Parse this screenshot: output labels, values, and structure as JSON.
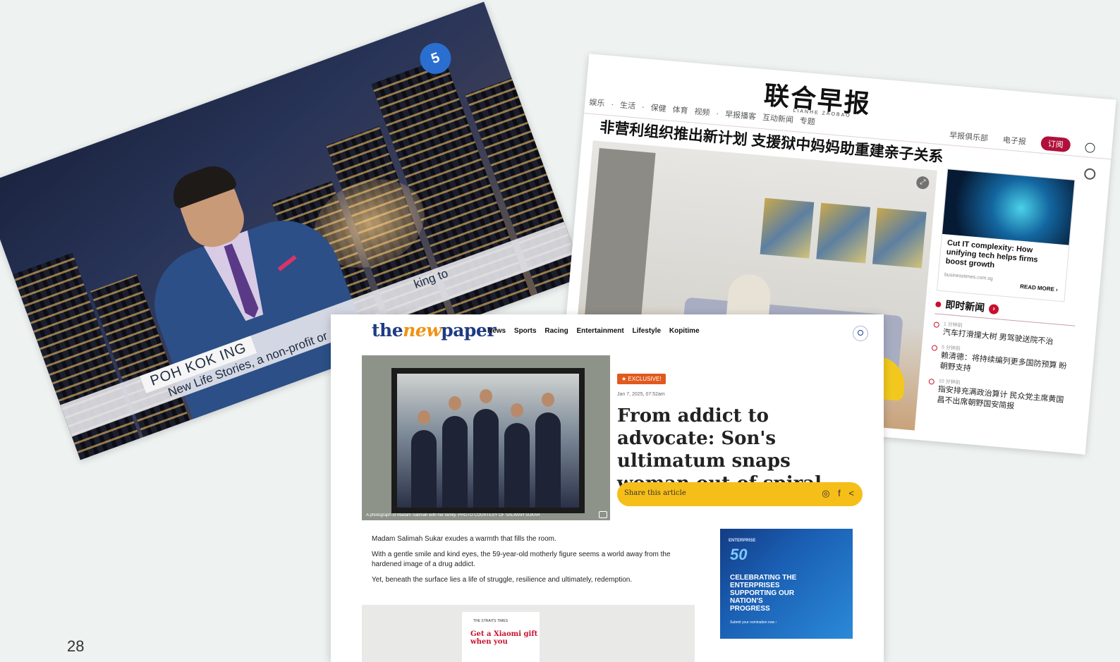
{
  "tv": {
    "channel_logo": "5",
    "anchor_name": "POH KOK ING",
    "ticker": "New Life Stories, a non-profit or",
    "ticker_fragment": "king to"
  },
  "zaobao": {
    "logo": "联合早报",
    "logo_sub": "LIANHE ZAOBAO",
    "nav": "娱乐 · 生活 · 保健 体育 视频 · 早报播客 互动新闻 专题",
    "nav_right": [
      "早报俱乐部",
      "电子报"
    ],
    "subscribe": "订阅",
    "headline": "非营利组织推出新计划 支援狱中妈妈助重建亲子关系",
    "ad": {
      "title": "Cut IT complexity: How unifying tech helps firms boost growth",
      "domain": "businesstimes.com.sg",
      "cta": "READ MORE ›"
    },
    "live_news": {
      "title": "即时新闻",
      "items": [
        {
          "time": "1 分钟前",
          "text": "汽车打滑撞大树 男驾驶送院不治"
        },
        {
          "time": "5 分钟前",
          "text": "赖清德：将持续编列更多国防预算 盼朝野支持"
        },
        {
          "time": "10 分钟前",
          "text": "指安排充满政治算计 民众党主席黄国昌不出席朝野国安简报"
        }
      ]
    }
  },
  "tnp": {
    "logo_the": "the",
    "logo_new": "new",
    "logo_paper": "paper",
    "nav": [
      "News",
      "Sports",
      "Racing",
      "Entertainment",
      "Lifestyle",
      "Kopitime"
    ],
    "photo_caption": "A photograph of Madam Salimah with her family. PHOTO COURTESY OF SALIMAH SUKAR",
    "badge": "EXCLUSIVE!",
    "date": "Jan 7, 2025, 07:52am",
    "title": "From addict to advocate: Son's ultimatum snaps woman out of spiral",
    "share_label": "Share this article",
    "share_icons": "◎ f <",
    "paragraphs": [
      "Madam Salimah Sukar exudes a warmth that fills the room.",
      "With a gentle smile and kind eyes, the 59-year-old motherly figure seems a world away from the hardened image of a drug addict.",
      "Yet, beneath the surface lies a life of struggle, resilience and ultimately, redemption."
    ],
    "side_ad": {
      "top": "ENTERPRISE",
      "num": "50",
      "text": "CELEBRATING THE ENTERPRISES SUPPORTING OUR NATION'S PROGRESS",
      "small": "Submit your nomination now ›"
    },
    "bottom_ad": {
      "top": "THE STRAITS TIMES",
      "text": "Get a Xiaomi gift when you"
    }
  },
  "page_number": "28"
}
